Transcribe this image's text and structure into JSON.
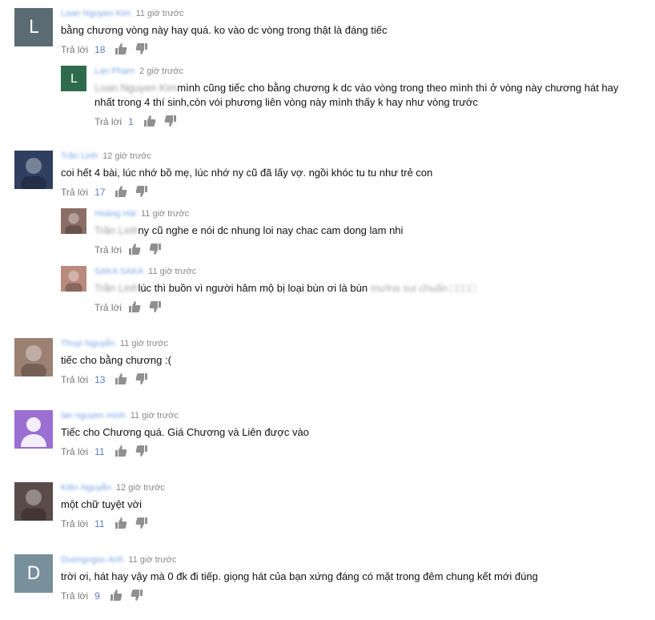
{
  "reply_label": "Trả lời",
  "comments": [
    {
      "author": "Loan Nguyen Kim",
      "time": "11 giờ trước",
      "text": "bằng chương vòng này hay quá. ko vào dc vòng trong thật là đáng tiếc",
      "likes": "18",
      "avatar": {
        "letter": "L",
        "color": "#5b6b74"
      },
      "replies": [
        {
          "author": "Lan Phạm",
          "time": "2 giờ trước",
          "mention": "Loan Nguyen Kim",
          "text": "mình cũng tiếc cho bằng chương k dc vào vòng trong theo mình thì ở vòng này chương hát hay nhất trong 4 thí sinh,còn vói phương liên vòng này mình thấy k hay như vòng trước",
          "likes": "1",
          "avatar": {
            "letter": "L",
            "color": "#2e6b4b"
          }
        }
      ]
    },
    {
      "author": "Trần Linh",
      "time": "12 giờ trước",
      "text": "coi hết 4 bài, lúc nhớ bồ mẹ, lúc nhớ ny cũ đã lấy vợ. ngồi khóc tu tu như trẻ con",
      "likes": "17",
      "avatar": {
        "letter": "",
        "color": "#2f3f60"
      },
      "replies": [
        {
          "author": "Hoàng Hải",
          "time": "11 giờ trước",
          "mention": "Trần Linh",
          "text": "ny cũ nghe e nói dc nhung loi nay chac cam dong lam nhi",
          "likes": "",
          "avatar": {
            "letter": "",
            "color": "#8a6e66"
          }
        },
        {
          "author": "SAKA SAKA",
          "time": "11 giờ trước",
          "mention": "Trần Linh",
          "text": "lúc thì buồn vì người hâm mộ bị loại bùn ơi là bùn",
          "trailing": "mưlna sui chuẩn □□□□",
          "likes": "",
          "avatar": {
            "letter": "",
            "color": "#b98a7e"
          }
        }
      ]
    },
    {
      "author": "Thuyi Nguyễn",
      "time": "11 giờ trước",
      "text": "tiếc cho bằng chương :(",
      "likes": "13",
      "avatar": {
        "letter": "",
        "color": "#9c8173"
      },
      "replies": []
    },
    {
      "author": "lan nguyen minh",
      "time": "11 giờ trước",
      "text": "Tiếc cho Chương quá. Giá Chương và Liên được vào",
      "likes": "11",
      "avatar": {
        "letter": "person",
        "color": "#9b6fd1"
      },
      "replies": []
    },
    {
      "author": "Kiên Nguyễn",
      "time": "12 giờ trước",
      "text": "một chữ tuyệt vời",
      "likes": "11",
      "avatar": {
        "letter": "",
        "color": "#5a4a49"
      },
      "replies": []
    },
    {
      "author": "Duongngoc Anh",
      "time": "11 giờ trước",
      "text": "trời ơi, hát hay vậy mà 0 đk đi tiếp. giọng hát của bạn xứng đáng có mặt trong đêm chung kết mới đúng",
      "likes": "9",
      "avatar": {
        "letter": "D",
        "color": "#78909c"
      },
      "replies": []
    }
  ]
}
